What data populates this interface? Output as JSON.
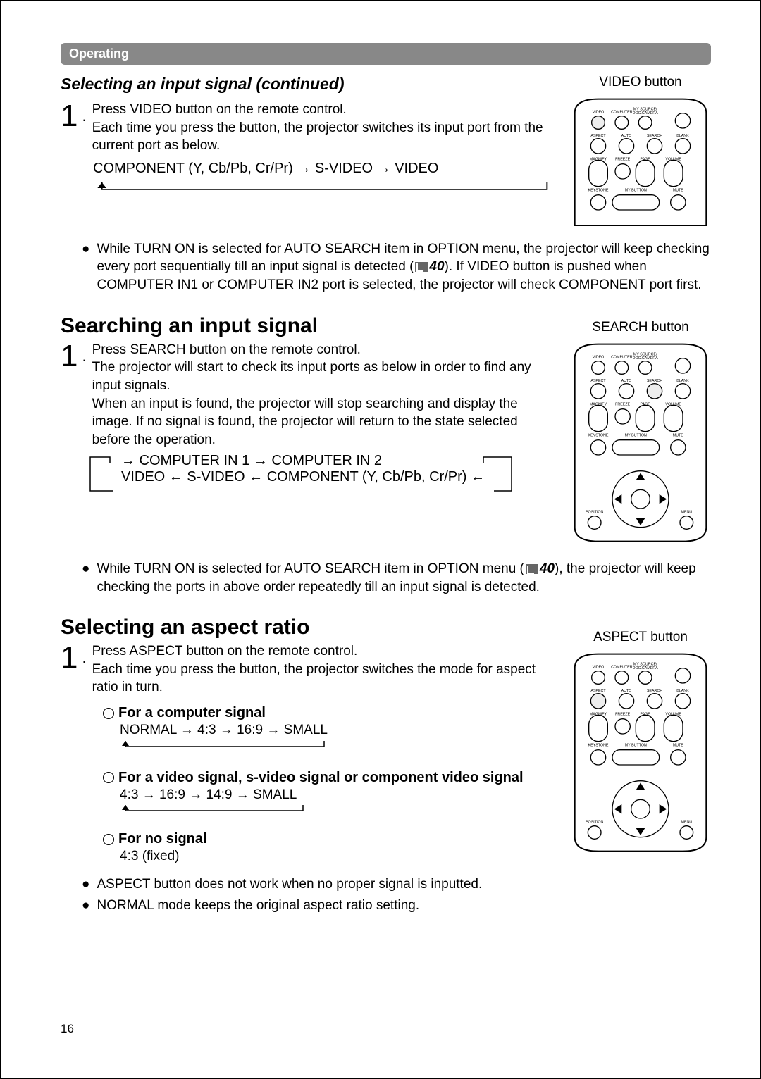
{
  "header_bar": "Operating",
  "section1": {
    "title": "Selecting an input signal (continued)",
    "right_label": "VIDEO button",
    "step1_line1": "Press VIDEO button on the remote control.",
    "step1_line2": "Each time you press the button, the projector switches its input port from the current port as below.",
    "cycle": "COMPONENT (Y, Cb/Pb, Cr/Pr) → S-VIDEO → VIDEO",
    "bullet1a": "While TURN ON is selected for AUTO SEARCH item in OPTION menu, the projector will keep checking every port sequentially till an input signal is detected (",
    "ref1": "40",
    "bullet1b": "). If VIDEO button is pushed when COMPUTER IN1 or COMPUTER IN2 port is selected, the projector will check COMPONENT port first."
  },
  "section2": {
    "title": "Searching an input signal",
    "right_label": "SEARCH button",
    "step1_line1": "Press SEARCH button on the remote control.",
    "step1_line2": "The projector will start to check its input ports as below in order to find any input signals.",
    "step1_line3": "When an input is found, the projector will stop searching and display the image. If no signal is found, the projector will return to the state selected before the operation.",
    "cycle_top": "→ COMPUTER IN 1 → COMPUTER IN 2",
    "cycle_bot": "VIDEO ← S-VIDEO ← COMPONENT (Y, Cb/Pb, Cr/Pr) ←",
    "bullet2a": "While TURN ON is selected for AUTO SEARCH item in OPTION menu (",
    "ref2": "40",
    "bullet2b": "), the projector will keep checking the ports in above order repeatedly till an input signal is detected."
  },
  "section3": {
    "title": "Selecting an aspect ratio",
    "right_label": "ASPECT button",
    "step1_line1": "Press ASPECT button on the remote control.",
    "step1_line2": "Each time you press the button, the projector switches the mode for aspect ratio in turn.",
    "sub1_title": "For a computer signal",
    "sub1_cycle": "NORMAL → 4:3 → 16:9 → SMALL",
    "sub2_title": "For a video signal, s-video signal or component video signal",
    "sub2_cycle": "4:3 → 16:9 → 14:9 → SMALL",
    "sub3_title": "For no signal",
    "sub3_text": "4:3 (fixed)",
    "bullet3": "ASPECT button does not work when no proper signal is inputted.",
    "bullet4": "NORMAL mode keeps the original aspect ratio setting."
  },
  "page_number": "16",
  "remote": {
    "row1": [
      "VIDEO",
      "COMPUTER",
      "MY SOURCE/DOC.CAMERA",
      ""
    ],
    "row2": [
      "ASPECT",
      "AUTO",
      "SEARCH",
      "BLANK"
    ],
    "row3": [
      "MAGNIFY",
      "FREEZE",
      "PAGE",
      "VOLUME"
    ],
    "row4": [
      "KEYSTONE",
      "MY BUTTON",
      "MUTE"
    ],
    "dpad": [
      "POSITION",
      "MENU"
    ]
  }
}
